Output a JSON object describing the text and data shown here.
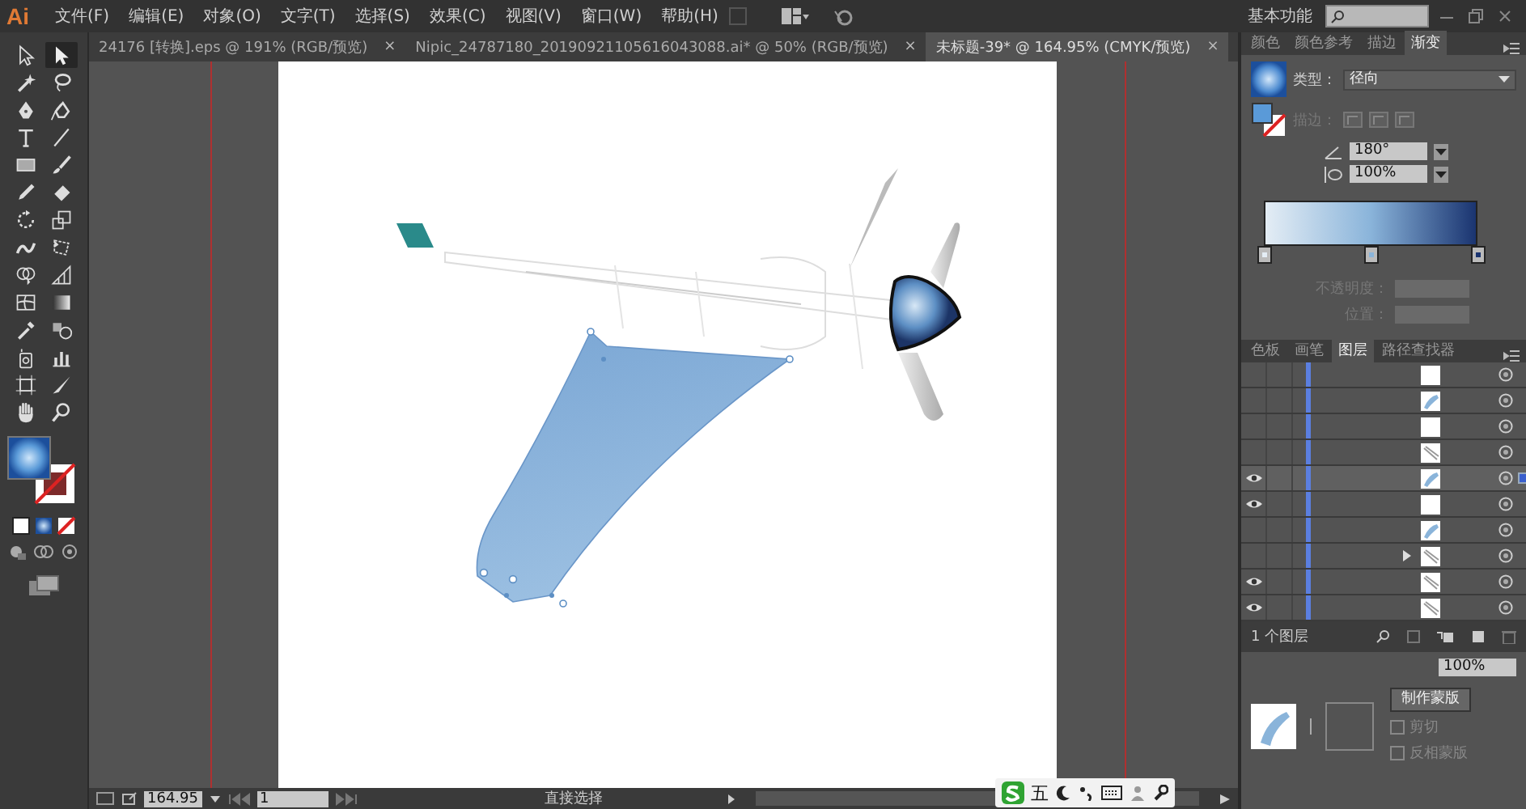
{
  "menu_bar": {
    "logo": "Ai",
    "items": [
      "文件(F)",
      "编辑(E)",
      "对象(O)",
      "文字(T)",
      "选择(S)",
      "效果(C)",
      "视图(V)",
      "窗口(W)",
      "帮助(H)"
    ],
    "workspace": "基本功能"
  },
  "document_tabs": [
    {
      "title": "24176 [转换].eps @ 191% (RGB/预览)",
      "close": "×",
      "selected": false
    },
    {
      "title": "Nipic_24787180_20190921105616043088.ai* @ 50% (RGB/预览)",
      "close": "×",
      "selected": false
    },
    {
      "title": "未标题-39* @ 164.95% (CMYK/预览)",
      "close": "×",
      "selected": true
    }
  ],
  "tools": [
    {
      "kind": "selection",
      "selected": false
    },
    {
      "kind": "direct-selection",
      "selected": true
    },
    {
      "kind": "magic-wand",
      "selected": false
    },
    {
      "kind": "lasso",
      "selected": false
    },
    {
      "kind": "pen",
      "selected": false
    },
    {
      "kind": "curvature",
      "selected": false
    },
    {
      "kind": "type",
      "selected": false
    },
    {
      "kind": "line",
      "selected": false
    },
    {
      "kind": "rectangle",
      "selected": false
    },
    {
      "kind": "brush",
      "selected": false
    },
    {
      "kind": "pencil",
      "selected": false
    },
    {
      "kind": "eraser",
      "selected": false
    },
    {
      "kind": "rotate",
      "selected": false
    },
    {
      "kind": "scale",
      "selected": false
    },
    {
      "kind": "warp",
      "selected": false
    },
    {
      "kind": "free-transform",
      "selected": false
    },
    {
      "kind": "shape-builder",
      "selected": false
    },
    {
      "kind": "perspective",
      "selected": false
    },
    {
      "kind": "mesh",
      "selected": false
    },
    {
      "kind": "gradient",
      "selected": false
    },
    {
      "kind": "eyedropper",
      "selected": false
    },
    {
      "kind": "blend",
      "selected": false
    },
    {
      "kind": "symbol",
      "selected": false
    },
    {
      "kind": "graph",
      "selected": false
    },
    {
      "kind": "artboard",
      "selected": false
    },
    {
      "kind": "slice",
      "selected": false
    },
    {
      "kind": "hand",
      "selected": false
    },
    {
      "kind": "zoom",
      "selected": false
    }
  ],
  "gradient_panel": {
    "tabs": [
      {
        "label": "颜色",
        "selected": false
      },
      {
        "label": "颜色参考",
        "selected": false
      },
      {
        "label": "描边",
        "selected": false
      },
      {
        "label": "渐变",
        "selected": true
      }
    ],
    "type_label": "类型：",
    "type_value": "径向",
    "stroke_label": "描边：",
    "angle": "180°",
    "aspect": "100%",
    "stops": [
      {
        "color": "#e4edf5"
      },
      {
        "color": "#8ab4da"
      },
      {
        "color": "#1a3470"
      }
    ],
    "opacity_label": "不透明度：",
    "position_label": "位置："
  },
  "layers_panel": {
    "tabs": [
      {
        "label": "色板",
        "selected": false
      },
      {
        "label": "画笔",
        "selected": false
      },
      {
        "label": "图层",
        "selected": true
      },
      {
        "label": "路径查找器",
        "selected": false
      }
    ],
    "rows": [
      {
        "visible": false,
        "kind": "blank",
        "expandable": false,
        "selected": false
      },
      {
        "visible": false,
        "kind": "shape",
        "expandable": false,
        "selected": false
      },
      {
        "visible": false,
        "kind": "blank",
        "expandable": false,
        "selected": false
      },
      {
        "visible": false,
        "kind": "lines",
        "expandable": false,
        "selected": false
      },
      {
        "visible": true,
        "kind": "shape",
        "expandable": false,
        "selected": true
      },
      {
        "visible": true,
        "kind": "blank",
        "expandable": false,
        "selected": false
      },
      {
        "visible": false,
        "kind": "shape",
        "expandable": false,
        "selected": false
      },
      {
        "visible": false,
        "kind": "lines",
        "expandable": true,
        "selected": false
      },
      {
        "visible": true,
        "kind": "lines",
        "expandable": false,
        "selected": false
      },
      {
        "visible": true,
        "kind": "lines",
        "expandable": false,
        "selected": false
      }
    ],
    "footer": "1 个图层"
  },
  "transparency_panel": {
    "opacity": "100%",
    "make_mask": "制作蒙版",
    "clip": {
      "label": "剪切",
      "checked": false
    },
    "invert": {
      "label": "反相蒙版",
      "checked": false
    }
  },
  "status_bar": {
    "zoom": "164.95",
    "artboard": "1",
    "tool": "直接选择"
  },
  "ime_bar": {
    "label": "五"
  }
}
